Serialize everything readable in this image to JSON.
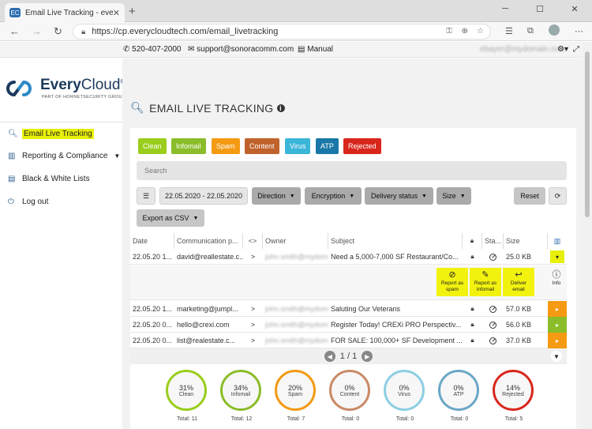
{
  "browser": {
    "tab_title": "Email Live Tracking - everycloud",
    "tab_favicon": "EC",
    "url": "https://cp.everycloudtech.com/email_livetracking"
  },
  "topbar": {
    "phone": "520-407-2000",
    "email": "support@sonoracomm.com",
    "manual": "Manual",
    "user": "ebayer@mydomain.com"
  },
  "logo": {
    "name_bold": "Every",
    "name_light": "Cloud",
    "reg": "®",
    "tagline": "PART OF HORNETSECURITY GROUP"
  },
  "sidebar": {
    "items": [
      {
        "label": "Email Live Tracking",
        "icon": "search-icon"
      },
      {
        "label": "Reporting & Compliance",
        "icon": "chart-icon"
      },
      {
        "label": "Black & White Lists",
        "icon": "list-icon"
      },
      {
        "label": "Log out",
        "icon": "power-icon"
      }
    ]
  },
  "page": {
    "title": "EMAIL LIVE TRACKING"
  },
  "categories": [
    {
      "label": "Clean",
      "color": "#9acd1c"
    },
    {
      "label": "Infomail",
      "color": "#8bbd2a"
    },
    {
      "label": "Spam",
      "color": "#f49a13"
    },
    {
      "label": "Content",
      "color": "#c0622b"
    },
    {
      "label": "Virus",
      "color": "#3bb5d8"
    },
    {
      "label": "ATP",
      "color": "#1978a8"
    },
    {
      "label": "Rejected",
      "color": "#d9261c"
    }
  ],
  "search": {
    "placeholder": "Search"
  },
  "filters": {
    "date_range": "22.05.2020 - 22.05.2020",
    "direction": "Direction",
    "encryption": "Encryption",
    "delivery_status": "Delivery status",
    "size": "Size",
    "reset": "Reset",
    "export": "Export as CSV"
  },
  "table": {
    "headers": [
      "Date",
      "Communication p...",
      "<>",
      "Owner",
      "Subject",
      "",
      "Sta...",
      "Size"
    ],
    "rows": [
      {
        "date": "22.05.20 1...",
        "comm": "david@reallestate.c...",
        "dir": ">",
        "owner": "john.smith@mydomain.com",
        "subject": "Need a 5,000-7,000 SF Restaurant/Co...",
        "size": "25.0 KB",
        "color": "#e8f00a",
        "arrow": "▾"
      },
      {
        "date": "22.05.20 1...",
        "comm": "marketing@jumpl...",
        "dir": ">",
        "owner": "john.smith@mydomain.com",
        "subject": "Saluting Our Veterans",
        "size": "57.0 KB",
        "color": "#f49a13",
        "arrow": "▸"
      },
      {
        "date": "22.05.20 0...",
        "comm": "hello@crexi.com",
        "dir": ">",
        "owner": "john.smith@mydomain.com",
        "subject": "Register Today! CREXi PRO Perspectiv...",
        "size": "56.0 KB",
        "color": "#8bbd2a",
        "arrow": "▸"
      },
      {
        "date": "22.05.20 0...",
        "comm": "list@realestate.c...",
        "dir": ">",
        "owner": "john.smith@mydomain.com",
        "subject": "FOR SALE: 100,000+ SF Development ...",
        "size": "37.0 KB",
        "color": "#f49a13",
        "arrow": "▸"
      }
    ]
  },
  "actions": [
    {
      "label1": "Report as",
      "label2": "spam",
      "icon": "ban-icon"
    },
    {
      "label1": "Report as",
      "label2": "infomail",
      "icon": "edit-icon"
    },
    {
      "label1": "Deliver",
      "label2": "email",
      "icon": "reply-icon"
    },
    {
      "label1": "Info",
      "label2": "",
      "icon": "info-icon"
    }
  ],
  "pager": {
    "text": "1 / 1"
  },
  "stats": [
    {
      "pct": "31%",
      "label": "Clean",
      "total": "Total: 11",
      "color": "#9acd1c"
    },
    {
      "pct": "34%",
      "label": "Infomail",
      "total": "Total: 12",
      "color": "#8bbd2a"
    },
    {
      "pct": "20%",
      "label": "Spam",
      "total": "Total: 7",
      "color": "#f49a13"
    },
    {
      "pct": "0%",
      "label": "Content",
      "total": "Total: 0",
      "color": "#c98a66"
    },
    {
      "pct": "0%",
      "label": "Virus",
      "total": "Total: 0",
      "color": "#8ccfe3"
    },
    {
      "pct": "0%",
      "label": "ATP",
      "total": "Total: 0",
      "color": "#6aa7c6"
    },
    {
      "pct": "14%",
      "label": "Rejected",
      "total": "Total: 5",
      "color": "#d9261c"
    }
  ]
}
